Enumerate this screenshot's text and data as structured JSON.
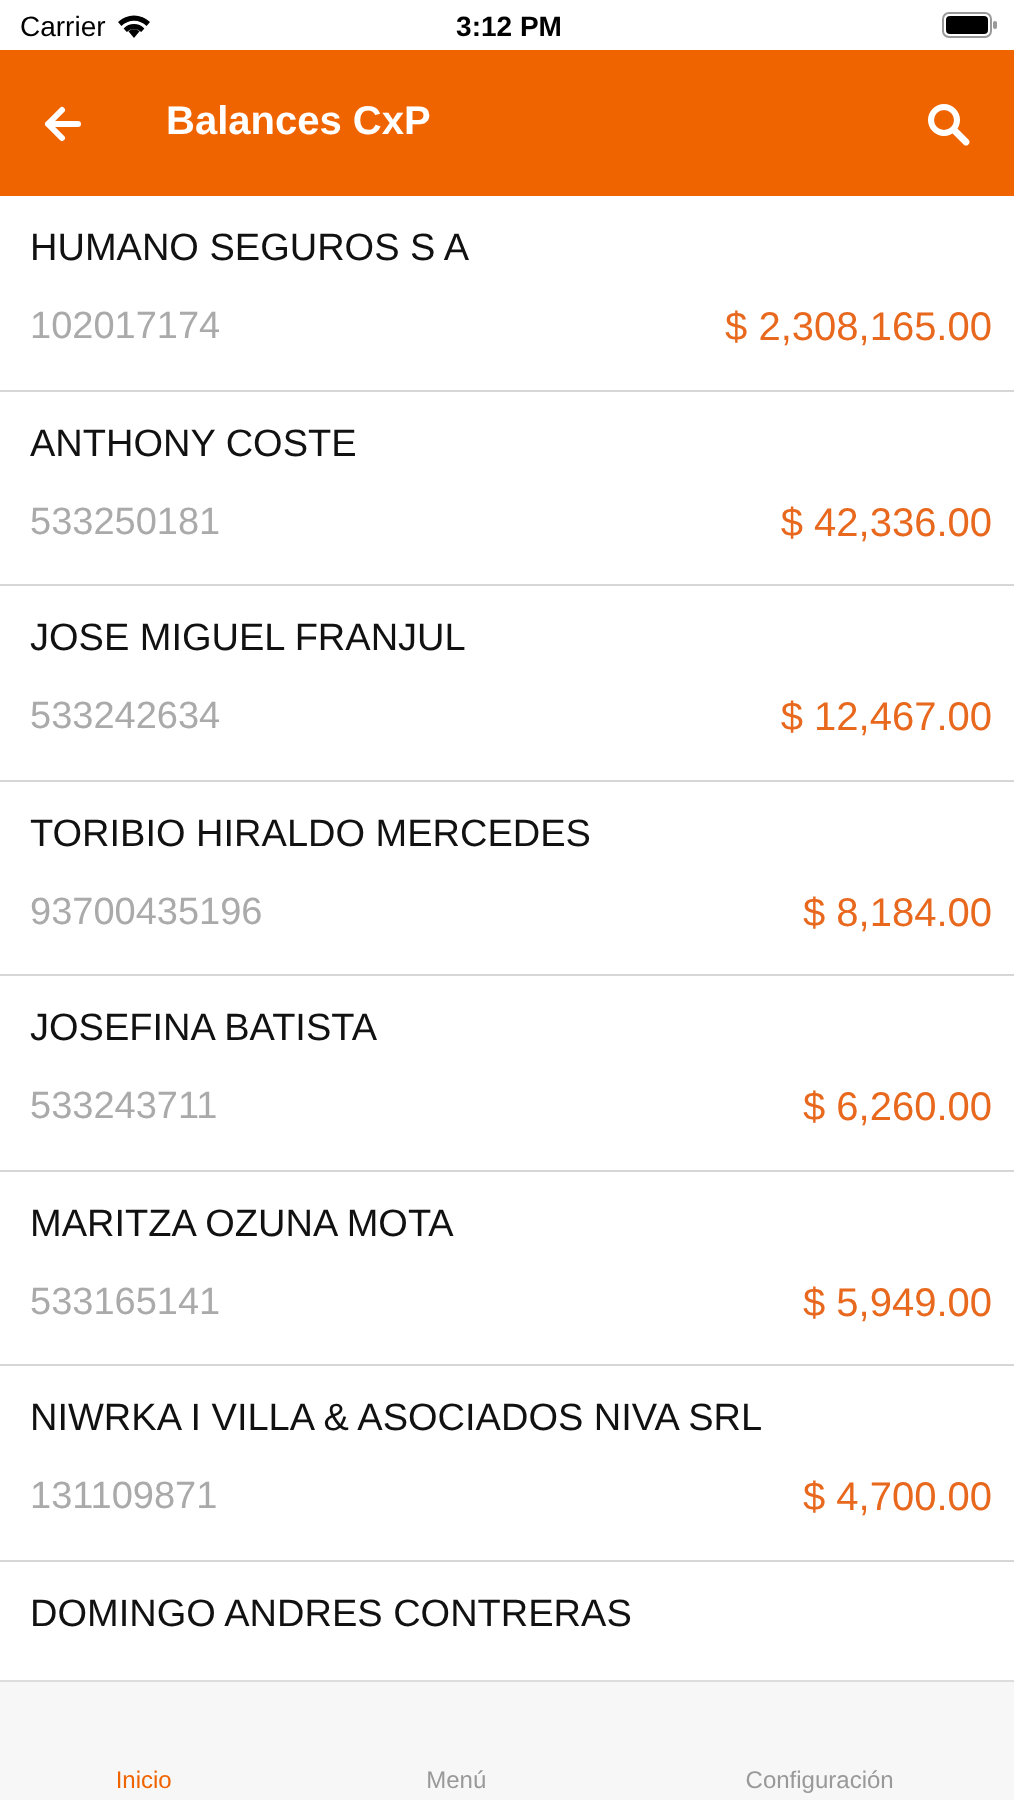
{
  "status_bar": {
    "carrier": "Carrier",
    "time": "3:12 PM"
  },
  "header": {
    "title": "Balances CxP"
  },
  "rows": [
    {
      "name": "HUMANO SEGUROS S A",
      "number": "102017174",
      "amount": "$ 2,308,165.00"
    },
    {
      "name": "ANTHONY COSTE",
      "number": "533250181",
      "amount": "$ 42,336.00"
    },
    {
      "name": "JOSE MIGUEL FRANJUL",
      "number": "533242634",
      "amount": "$ 12,467.00"
    },
    {
      "name": "TORIBIO HIRALDO MERCEDES",
      "number": "93700435196",
      "amount": "$ 8,184.00"
    },
    {
      "name": "JOSEFINA BATISTA",
      "number": "533243711",
      "amount": "$ 6,260.00"
    },
    {
      "name": "MARITZA OZUNA MOTA",
      "number": "533165141",
      "amount": "$ 5,949.00"
    },
    {
      "name": "NIWRKA I VILLA & ASOCIADOS NIVA SRL",
      "number": "131109871",
      "amount": "$ 4,700.00"
    },
    {
      "name": "DOMINGO ANDRES CONTRERAS"
    }
  ],
  "tab_bar": [
    {
      "label": "Inicio",
      "selected": true
    },
    {
      "label": "Menú",
      "selected": false
    },
    {
      "label": "Configuración",
      "selected": false
    }
  ]
}
